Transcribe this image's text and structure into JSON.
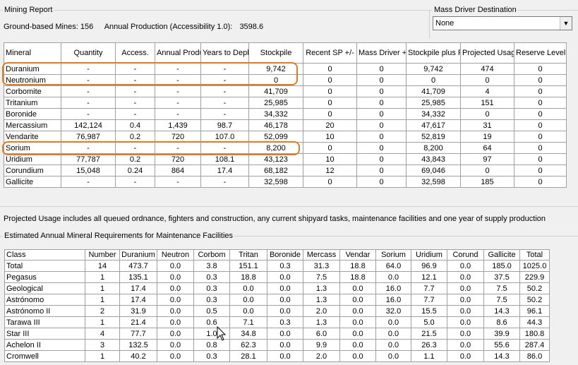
{
  "mining_report": {
    "title": "Mining Report",
    "summary_mines_label": "Ground-based Mines:",
    "summary_mines_value": "156",
    "summary_production_label": "Annual Production (Accessibility 1.0):",
    "summary_production_value": "3598.6"
  },
  "mass_driver": {
    "title": "Mass Driver Destination",
    "selected": "None"
  },
  "mineral_table": {
    "headers": [
      "Mineral",
      "Quantity",
      "Access.",
      "Annual Production",
      "Years to Depletion",
      "Stockpile",
      "Recent SP +/-",
      "Mass Driver +/-",
      "Stockpile plus Production",
      "Projected Usage",
      "Reserve Level"
    ],
    "rows": [
      [
        "Duranium",
        "-",
        "-",
        "-",
        "-",
        "9,742",
        "0",
        "0",
        "9,742",
        "474",
        "0"
      ],
      [
        "Neutronium",
        "-",
        "-",
        "-",
        "-",
        "0",
        "0",
        "0",
        "0",
        "0",
        "0"
      ],
      [
        "Corbomite",
        "-",
        "-",
        "-",
        "-",
        "41,709",
        "0",
        "0",
        "41,709",
        "4",
        "0"
      ],
      [
        "Tritanium",
        "-",
        "-",
        "-",
        "-",
        "25,985",
        "0",
        "0",
        "25,985",
        "151",
        "0"
      ],
      [
        "Boronide",
        "-",
        "-",
        "-",
        "-",
        "34,332",
        "0",
        "0",
        "34,332",
        "0",
        "0"
      ],
      [
        "Mercassium",
        "142,124",
        "0.4",
        "1,439",
        "98.7",
        "46,178",
        "20",
        "0",
        "47,617",
        "31",
        "0"
      ],
      [
        "Vendarite",
        "76,987",
        "0.2",
        "720",
        "107.0",
        "52,099",
        "10",
        "0",
        "52,819",
        "19",
        "0"
      ],
      [
        "Sorium",
        "-",
        "-",
        "-",
        "-",
        "8,200",
        "0",
        "0",
        "8,200",
        "64",
        "0"
      ],
      [
        "Uridium",
        "77,787",
        "0.2",
        "720",
        "108.1",
        "43,123",
        "10",
        "0",
        "43,843",
        "97",
        "0"
      ],
      [
        "Corundium",
        "15,048",
        "0.24",
        "864",
        "17.4",
        "68,182",
        "12",
        "0",
        "69,046",
        "0",
        "0"
      ],
      [
        "Gallicite",
        "-",
        "-",
        "-",
        "-",
        "32,598",
        "0",
        "0",
        "32,598",
        "185",
        "0"
      ]
    ]
  },
  "note": "Projected Usage includes all queued ordnance, fighters and construction, any current shipyard tasks, maintenance facilities and one year of supply production",
  "maintenance": {
    "title": "Estimated Annual Mineral Requirements for Maintenance Facilities",
    "headers": [
      "Class",
      "Number",
      "Duranium",
      "Neutron",
      "Corbom",
      "Tritan",
      "Boronide",
      "Mercass",
      "Vendar",
      "Sorium",
      "Uridium",
      "Corund",
      "Gallicite",
      "Total"
    ],
    "rows": [
      [
        "Total",
        "14",
        "473.7",
        "0.0",
        "3.8",
        "151.1",
        "0.3",
        "31.3",
        "18.8",
        "64.0",
        "96.9",
        "0.0",
        "185.0",
        "1025.0"
      ],
      [
        "Pegasus",
        "1",
        "135.1",
        "0.0",
        "0.3",
        "18.8",
        "0.0",
        "7.5",
        "18.8",
        "0.0",
        "12.1",
        "0.0",
        "37.5",
        "229.9"
      ],
      [
        "Geological",
        "1",
        "17.4",
        "0.0",
        "0.3",
        "0.0",
        "0.0",
        "1.3",
        "0.0",
        "16.0",
        "7.7",
        "0.0",
        "7.5",
        "50.2"
      ],
      [
        "Astrónomo",
        "1",
        "17.4",
        "0.0",
        "0.3",
        "0.0",
        "0.0",
        "1.3",
        "0.0",
        "16.0",
        "7.7",
        "0.0",
        "7.5",
        "50.2"
      ],
      [
        "Astrónomo II",
        "2",
        "31.9",
        "0.0",
        "0.5",
        "0.0",
        "0.0",
        "2.0",
        "0.0",
        "32.0",
        "15.5",
        "0.0",
        "14.3",
        "96.1"
      ],
      [
        "Tarawa III",
        "1",
        "21.4",
        "0.0",
        "0.6",
        "7.1",
        "0.3",
        "1.3",
        "0.0",
        "0.0",
        "5.0",
        "0.0",
        "8.6",
        "44.3"
      ],
      [
        "Star III",
        "4",
        "77.7",
        "0.0",
        "1.0",
        "34.8",
        "0.0",
        "6.0",
        "0.0",
        "0.0",
        "21.5",
        "0.0",
        "39.9",
        "180.8"
      ],
      [
        "Achelon II",
        "3",
        "132.5",
        "0.0",
        "0.8",
        "62.3",
        "0.0",
        "9.9",
        "0.0",
        "0.0",
        "26.3",
        "0.0",
        "55.6",
        "287.4"
      ],
      [
        "Cromwell",
        "1",
        "40.2",
        "0.0",
        "0.3",
        "28.1",
        "0.0",
        "2.0",
        "0.0",
        "0.0",
        "1.1",
        "0.0",
        "14.3",
        "86.0"
      ]
    ]
  },
  "icons": {
    "dropdown": "chevron-down-icon",
    "cursor": "mouse-pointer-icon"
  },
  "colors": {
    "highlight": "#e07b20"
  }
}
